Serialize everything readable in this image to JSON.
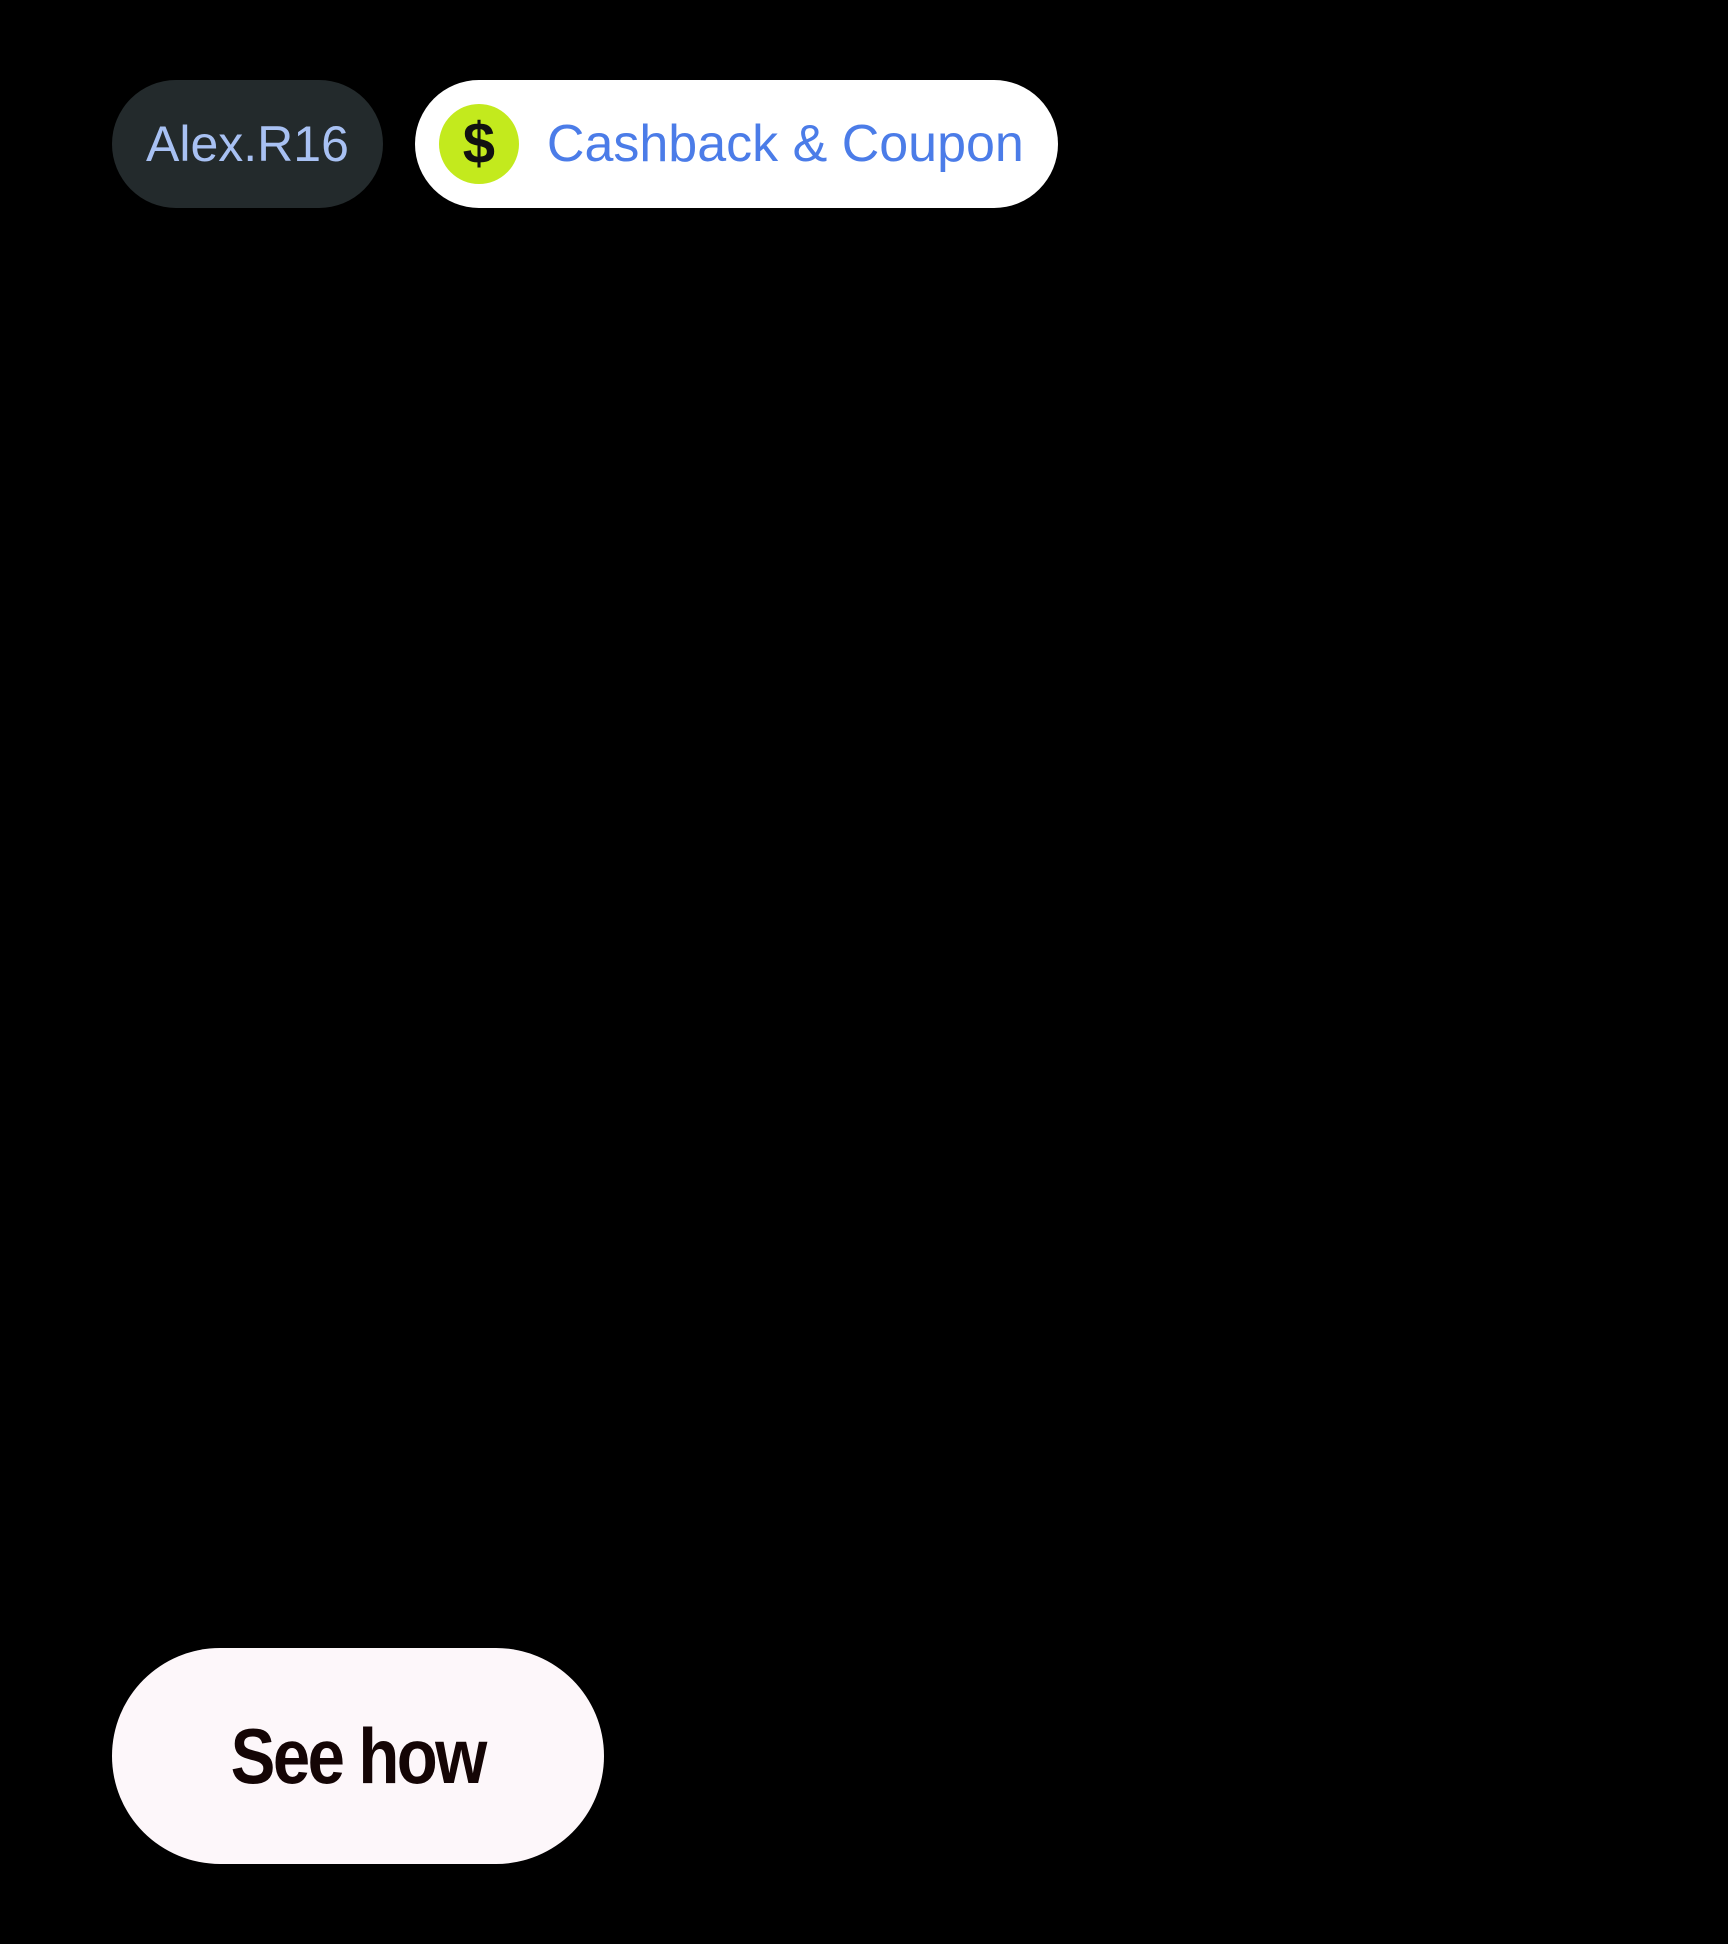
{
  "header": {
    "user_chip": {
      "label": "Alex.R16"
    },
    "cashback_chip": {
      "icon": "dollar-icon",
      "icon_glyph": "$",
      "label": "Cashback & Coupon"
    }
  },
  "cta": {
    "label": "See how"
  },
  "colors": {
    "background": "#000000",
    "user_chip_bg": "#232a2c",
    "user_chip_text": "#a8c1f3",
    "cashback_chip_bg": "#ffffff",
    "cashback_text": "#4b7ce8",
    "dollar_icon_bg": "#c3ea1d",
    "cta_bg": "#fdf7fa",
    "cta_text": "#140505"
  }
}
